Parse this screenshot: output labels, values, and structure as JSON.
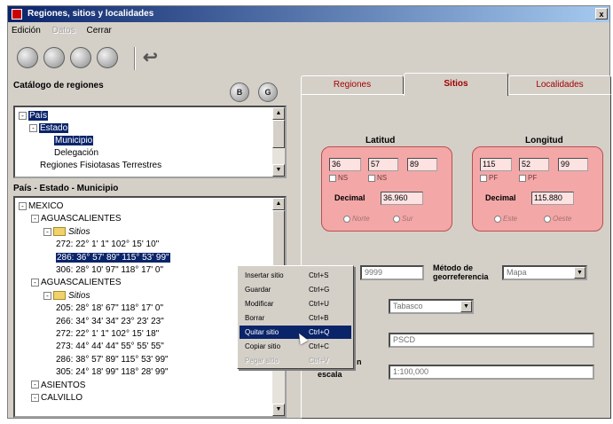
{
  "window": {
    "title": "Regiones, sitios y localidades",
    "close_label": "x"
  },
  "menu": {
    "items": [
      {
        "label": "Edición",
        "enabled": true
      },
      {
        "label": "Datos",
        "enabled": false
      },
      {
        "label": "Cerrar",
        "enabled": true
      }
    ]
  },
  "toolbar": {
    "icons": [
      "disk-icon",
      "open-icon",
      "gear-icon",
      "edit-icon",
      "exit-icon"
    ]
  },
  "catalog": {
    "title": "Catálogo de regiones",
    "btn1": "B",
    "btn2": "G",
    "tree": [
      {
        "label": "País",
        "selected": true,
        "expander": "-"
      },
      {
        "label": "Estado",
        "selected": true,
        "expander": "-"
      },
      {
        "label": "Municipio",
        "selected": true
      },
      {
        "label": "Delegación",
        "selected": false
      },
      {
        "label": "Regiones Fisiotasas Terrestres",
        "selected": false
      }
    ]
  },
  "hierarchy": {
    "title": "País - Estado - Municipio",
    "tree": [
      {
        "label": "MEXICO",
        "indent": 0,
        "expander": "-"
      },
      {
        "label": "AGUASCALIENTES",
        "indent": 1
      },
      {
        "label": "Sitios",
        "indent": 2,
        "folder": true,
        "italic": true
      },
      {
        "label": "272: 22° 1' 1\" 102° 15' 10\"",
        "indent": 3
      },
      {
        "label": "286: 36° 57' 89\" 115° 53' 99\"",
        "indent": 3,
        "selected": true
      },
      {
        "label": "306: 28° 10' 97\" 118° 17' 0\"",
        "indent": 3
      },
      {
        "label": "AGUASCALIENTES",
        "indent": 1
      },
      {
        "label": "Sitios",
        "indent": 2,
        "folder": true,
        "italic": true
      },
      {
        "label": "205: 28° 18' 67\" 118° 17' 0\"",
        "indent": 3
      },
      {
        "label": "266: 34° 34' 34\" 23° 23' 23\"",
        "indent": 3
      },
      {
        "label": "272: 22° 1' 1\" 102° 15' 18\"",
        "indent": 3
      },
      {
        "label": "273: 44° 44' 44\" 55° 55' 55\"",
        "indent": 3
      },
      {
        "label": "286: 38° 57' 89\" 115° 53' 99\"",
        "indent": 3
      },
      {
        "label": "305: 24° 18' 99\" 118° 28' 99\"",
        "indent": 3
      },
      {
        "label": "ASIENTOS",
        "indent": 1
      },
      {
        "label": "CALVILLO",
        "indent": 1
      }
    ]
  },
  "tabs": [
    {
      "label": "Regiones",
      "active": false
    },
    {
      "label": "Sitios",
      "active": true
    },
    {
      "label": "Localidades",
      "active": false
    }
  ],
  "latitud": {
    "title": "Latitud",
    "deg": "36",
    "min": "57",
    "sec": "89",
    "cb1": "NS",
    "cb2": "NS",
    "decimal_label": "Decimal",
    "decimal": "36.960",
    "radio1": "Norte",
    "radio2": "Sur"
  },
  "longitud": {
    "title": "Longitud",
    "deg": "115",
    "min": "52",
    "sec": "99",
    "cb1": "PF",
    "cb2": "PF",
    "decimal_label": "Decimal",
    "decimal": "115.880",
    "radio1": "Este",
    "radio2": "Oeste"
  },
  "form": {
    "id_value": "9999",
    "metodo_label": "Método de georreferencia",
    "metodo_value": "Mapa",
    "tipo_value": "Tabasco",
    "field2_value": "PSCD",
    "escala_label": "escala",
    "escala_partial": "n",
    "escala_value": "1:100,000"
  },
  "context_menu": [
    {
      "label": "Insertar sitio",
      "shortcut": "Ctrl+S",
      "state": "normal"
    },
    {
      "label": "Guardar",
      "shortcut": "Ctrl+G",
      "state": "normal"
    },
    {
      "label": "Modificar",
      "shortcut": "Ctrl+U",
      "state": "normal"
    },
    {
      "label": "Borrar",
      "shortcut": "Ctrl+B",
      "state": "normal"
    },
    {
      "label": "Quitar sitio",
      "shortcut": "Ctrl+Q",
      "state": "highlight"
    },
    {
      "label": "Copiar sitio",
      "shortcut": "Ctrl+C",
      "state": "normal"
    },
    {
      "label": "Pegar sitio",
      "shortcut": "Ctrl+V",
      "state": "disabled"
    }
  ],
  "colors": {
    "accent": "#0a246a",
    "coord_box": "#f4a7a7",
    "tab_text": "#a40000"
  }
}
